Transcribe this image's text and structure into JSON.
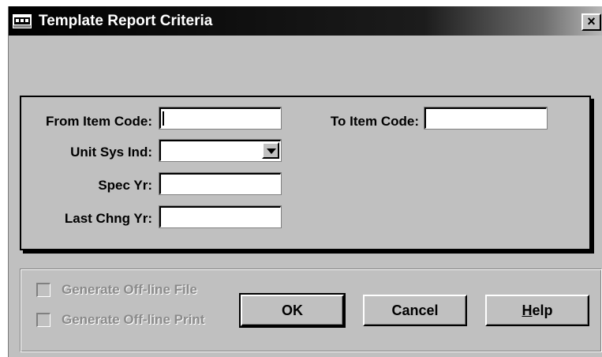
{
  "window": {
    "title": "Template Report Criteria",
    "close_label": "×",
    "title_icon": "app-window-icon"
  },
  "criteria": {
    "from_item_code": {
      "label": "From Item Code:",
      "value": ""
    },
    "to_item_code": {
      "label": "To Item Code:",
      "value": ""
    },
    "unit_sys_ind": {
      "label": "Unit Sys Ind:",
      "value": ""
    },
    "spec_yr": {
      "label": "Spec Yr:",
      "value": ""
    },
    "last_chng_yr": {
      "label": "Last Chng Yr:",
      "value": ""
    }
  },
  "options": {
    "generate_offline_file": {
      "label": "Generate Off-line File",
      "checked": false,
      "enabled": false
    },
    "generate_offline_print": {
      "label": "Generate Off-line Print",
      "checked": false,
      "enabled": false
    }
  },
  "buttons": {
    "ok": "OK",
    "cancel": "Cancel",
    "help_mnemonic": "H",
    "help_rest": "elp"
  },
  "colors": {
    "face": "#c0c0c0",
    "titlebar": "#000000",
    "disabled_text": "#8a8a8a"
  }
}
